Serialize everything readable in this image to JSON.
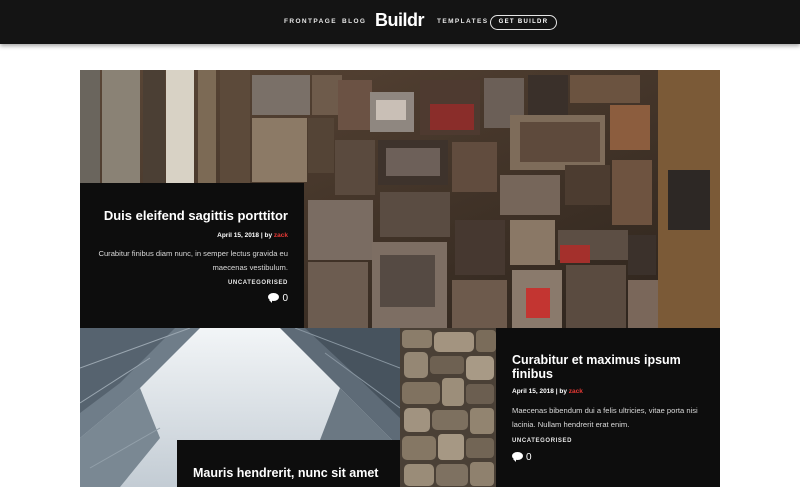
{
  "nav": {
    "links_left": [
      "FRONTPAGE",
      "BLOG"
    ],
    "logo": "Buildr",
    "links_right": [
      "TEMPLATES"
    ],
    "cta": "GET BUILDR"
  },
  "posts": [
    {
      "title": "Duis eleifend sagittis porttitor",
      "date": "April 15, 2018",
      "by": "| by",
      "author": "zack",
      "excerpt": "Curabitur finibus diam nunc, in semper lectus gravida eu maecenas vestibulum.",
      "category": "UNCATEGORISED",
      "comments": "0",
      "image_icon": "letterpress-type-image"
    },
    {
      "title": "Curabitur et maximus ipsum finibus",
      "date": "April 15, 2018",
      "by": "| by",
      "author": "zack",
      "excerpt": "Maecenas bibendum dui a felis ultricies, vitae porta nisi lacinia. Nullam hendrerit erat enim.",
      "category": "UNCATEGORISED",
      "comments": "0",
      "image_icon": "stone-wall-image"
    },
    {
      "title": "Mauris hendrerit, nunc sit amet",
      "image_icon": "architecture-image"
    }
  ],
  "colors": {
    "navbar_bg": "#141414",
    "card_bg": "#0d0d0d",
    "accent": "#e53935"
  }
}
